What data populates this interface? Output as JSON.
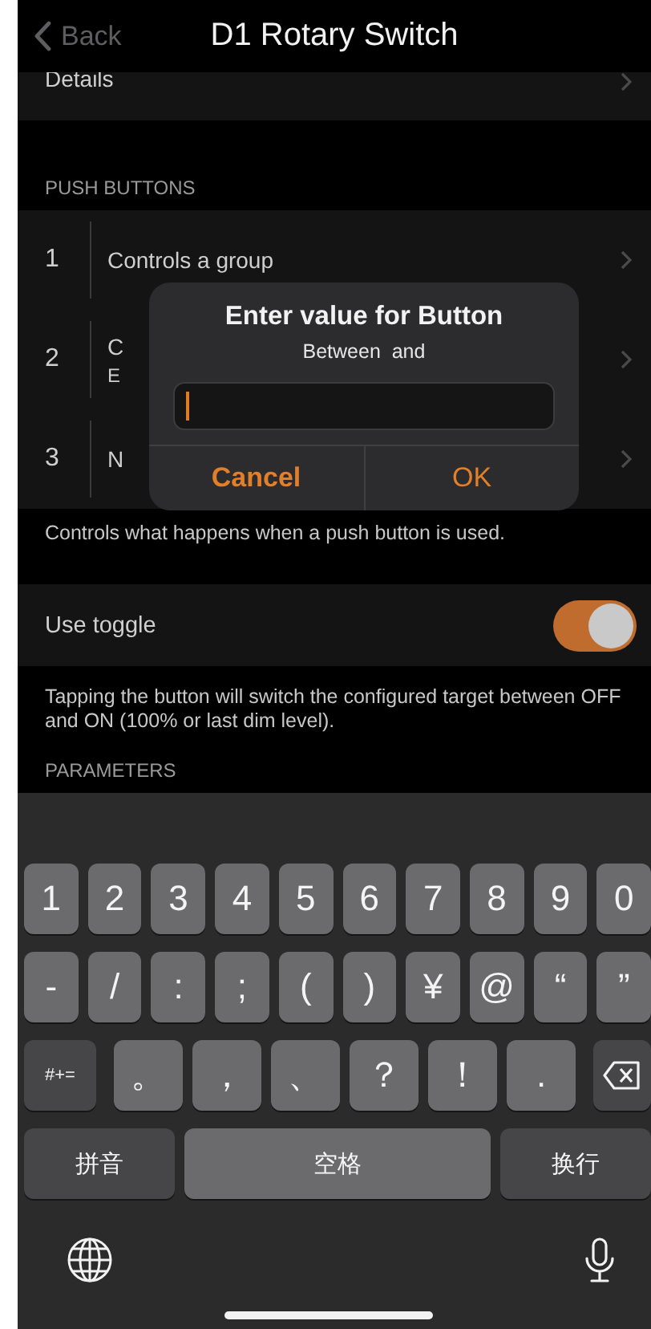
{
  "nav": {
    "back": "Back",
    "title": "D1 Rotary Switch"
  },
  "details": {
    "label": "Details"
  },
  "push_buttons": {
    "header": "PUSH BUTTONS",
    "items": [
      {
        "number": "1",
        "title": "Controls a group"
      },
      {
        "number": "2",
        "title": "C",
        "subtitle": "E"
      },
      {
        "number": "3",
        "title": "N"
      }
    ],
    "footer": "Controls what happens when a push button is used."
  },
  "toggle": {
    "label": "Use toggle",
    "on": true,
    "footer": "Tapping the button will switch the configured target between OFF and ON (100% or last dim level)."
  },
  "parameters": {
    "header": "PARAMETERS"
  },
  "dialog": {
    "title": "Enter value for Button",
    "message": "Between  and",
    "buttons": [
      {
        "label": "Cancel",
        "kind": "cancel"
      },
      {
        "label": "OK",
        "kind": "default"
      }
    ]
  },
  "keyboard": {
    "number_row": [
      {
        "label": "1",
        "kind": "char"
      },
      {
        "label": "2",
        "kind": "char"
      },
      {
        "label": "3",
        "kind": "char"
      },
      {
        "label": "4",
        "kind": "char"
      },
      {
        "label": "5",
        "kind": "char"
      },
      {
        "label": "6",
        "kind": "char"
      },
      {
        "label": "7",
        "kind": "char"
      },
      {
        "label": "8",
        "kind": "char"
      },
      {
        "label": "9",
        "kind": "char"
      },
      {
        "label": "0",
        "kind": "char"
      }
    ],
    "symbol_row": [
      {
        "label": "-",
        "kind": "char"
      },
      {
        "label": "/",
        "kind": "char"
      },
      {
        "label": ":",
        "kind": "char"
      },
      {
        "label": ";",
        "kind": "char"
      },
      {
        "label": "(",
        "kind": "char"
      },
      {
        "label": ")",
        "kind": "char"
      },
      {
        "label": "¥",
        "kind": "char"
      },
      {
        "label": "@",
        "kind": "char"
      },
      {
        "label": "“",
        "kind": "char"
      },
      {
        "label": "”",
        "kind": "char"
      }
    ],
    "punctuation_row": [
      {
        "label": "#+=",
        "kind": "function"
      },
      {
        "label": "。",
        "kind": "char"
      },
      {
        "label": "，",
        "kind": "char"
      },
      {
        "label": "、",
        "kind": "char"
      },
      {
        "label": "？",
        "kind": "char"
      },
      {
        "label": "！",
        "kind": "char"
      },
      {
        "label": ".",
        "kind": "char"
      },
      {
        "kind": "delete"
      }
    ],
    "bottom_row": [
      {
        "label": "拼音",
        "kind": "function"
      },
      {
        "label": "空格",
        "kind": "space"
      },
      {
        "label": "换行",
        "kind": "function"
      }
    ]
  }
}
